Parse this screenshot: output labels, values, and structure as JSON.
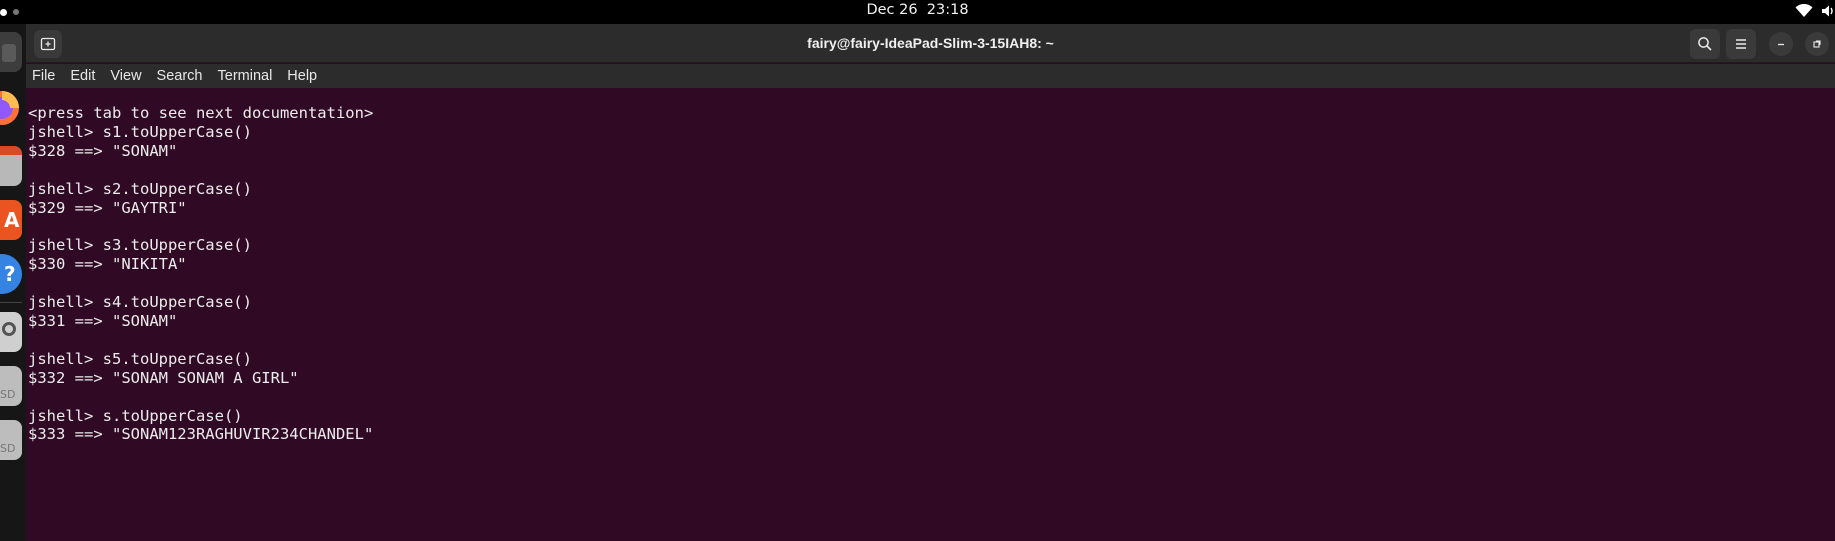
{
  "topbar": {
    "clock": "Dec 26  23:18",
    "icons": [
      "wifi-icon",
      "volume-icon"
    ]
  },
  "dock": {
    "icons": [
      "files-icon",
      "firefox-icon",
      "app-center-icon",
      "software-icon",
      "help-icon",
      "search-tool-icon",
      "sd-card-icon",
      "sd-card-icon"
    ]
  },
  "window": {
    "title": "fairy@fairy-IdeaPad-Slim-3-15IAH8: ~",
    "menu": [
      "File",
      "Edit",
      "View",
      "Search",
      "Terminal",
      "Help"
    ],
    "header_icons": [
      "new-tab-icon",
      "search-icon",
      "hamburger-menu-icon",
      "minimize-icon",
      "maximize-icon"
    ]
  },
  "terminal": {
    "lines": [
      "<press tab to see next documentation>",
      "jshell> s1.toUpperCase()",
      "$328 ==> \"SONAM\"",
      "",
      "jshell> s2.toUpperCase()",
      "$329 ==> \"GAYTRI\"",
      "",
      "jshell> s3.toUpperCase()",
      "$330 ==> \"NIKITA\"",
      "",
      "jshell> s4.toUpperCase()",
      "$331 ==> \"SONAM\"",
      "",
      "jshell> s5.toUpperCase()",
      "$332 ==> \"SONAM SONAM A GIRL\"",
      "",
      "jshell> s.toUpperCase()",
      "$333 ==> \"SONAM123RAGHUVIR234CHANDEL\""
    ]
  },
  "colors": {
    "terminal_bg": "#300a24",
    "terminal_fg": "#ececec",
    "header_bg": "#2c2c2c"
  }
}
